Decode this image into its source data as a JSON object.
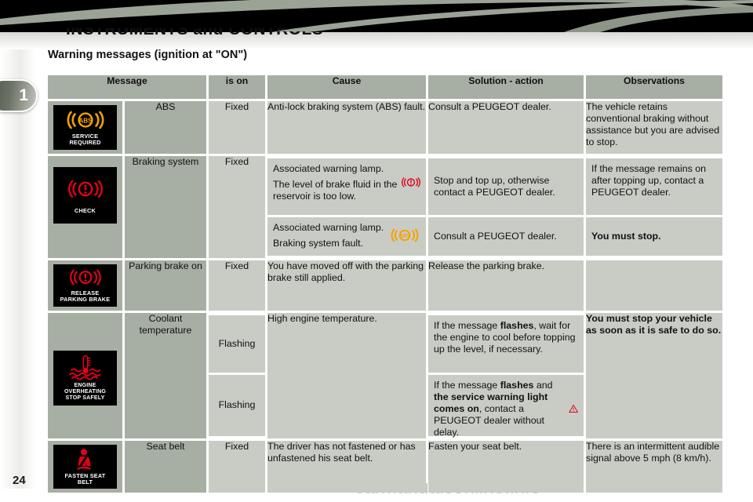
{
  "header": {
    "title": "INSTRUMENTS and CONTROLS",
    "chapter_tab": "1"
  },
  "page": {
    "number": "24",
    "watermark": "carmanualsonline.info"
  },
  "section": {
    "heading": "Warning messages (ignition at \"ON\")"
  },
  "table": {
    "columns": [
      "Message",
      "is on",
      "Cause",
      "Solution - action",
      "Observations"
    ],
    "rows": [
      {
        "display": {
          "icon": "abs-warning-icon",
          "caption_line1": "SERVICE",
          "caption_line2": "REQUIRED"
        },
        "message": "ABS",
        "is_on": "Fixed",
        "cause": "Anti-lock braking system (ABS) fault.",
        "solution": "Consult a PEUGEOT dealer.",
        "observation": "The vehicle retains conventional braking without assistance but you are advised to stop."
      },
      {
        "display": {
          "icon": "brake-check-icon",
          "caption_line1": "CHECK",
          "caption_line2": ""
        },
        "message": "Braking system",
        "is_on": "Fixed",
        "sub": [
          {
            "cause_line1": "Associated warning lamp.",
            "cause_line2": "The level of brake fluid in the reservoir is too low.",
            "cause_icon": "brake-warning-icon",
            "solution": "Stop and top up, otherwise contact a PEUGEOT dealer.",
            "observation": "If the message remains on after topping up, contact a PEUGEOT dealer.",
            "observation_bold": false
          },
          {
            "cause_line1": "Associated warning lamp.",
            "cause_line2": "Braking system fault.",
            "cause_icon": "abs-warning-icon",
            "solution": "Consult a PEUGEOT dealer.",
            "observation": "You must stop.",
            "observation_bold": true
          }
        ]
      },
      {
        "display": {
          "icon": "brake-check-icon",
          "caption_line1": "RELEASE",
          "caption_line2": "PARKING BRAKE"
        },
        "message": "Parking brake on",
        "is_on": "Fixed",
        "cause": "You have moved off with the parking brake still applied.",
        "solution": "Release the parking brake.",
        "observation": ""
      },
      {
        "display": {
          "icon": "coolant-temp-icon",
          "caption_line1": "ENGINE OVERHEATING",
          "caption_line2": "STOP SAFELY"
        },
        "message": "Coolant temperature",
        "is_on_1": "Flashing",
        "is_on_2": "Flashing",
        "cause": "High engine temperature.",
        "solution_1_parts": [
          {
            "t": "If the message ",
            "b": false
          },
          {
            "t": "flashes",
            "b": true
          },
          {
            "t": ", wait for the engine to cool before topping up the level, if necessary.",
            "b": false
          }
        ],
        "solution_2_parts": [
          {
            "t": "If the message ",
            "b": false
          },
          {
            "t": "flashes",
            "b": true
          },
          {
            "t": " and ",
            "b": false
          },
          {
            "t": "the service warning light comes on",
            "b": true
          },
          {
            "t": ", contact a PEUGEOT dealer without delay.",
            "b": false
          }
        ],
        "solution_2_icon": "warning-triangle-icon",
        "observation": "You must stop your vehicle as soon as it is safe to do so.",
        "observation_bold": true
      },
      {
        "display": {
          "icon": "seat-belt-icon",
          "caption_line1": "FASTEN SEAT",
          "caption_line2": "BELT"
        },
        "message": "Seat belt",
        "is_on": "Fixed",
        "cause": "The driver has not fastened or has unfastened his seat belt.",
        "solution": "Fasten your seat belt.",
        "observation": "There is an intermittent audible signal above 5 mph (8 km/h)."
      }
    ]
  },
  "colors": {
    "header_row": "#a7aea3",
    "cell_light": "#c8ccc5",
    "cell_dark": "#a7aea3",
    "warning_red": "#e2001a",
    "warning_orange": "#f5a200",
    "band_black": "#000000"
  }
}
